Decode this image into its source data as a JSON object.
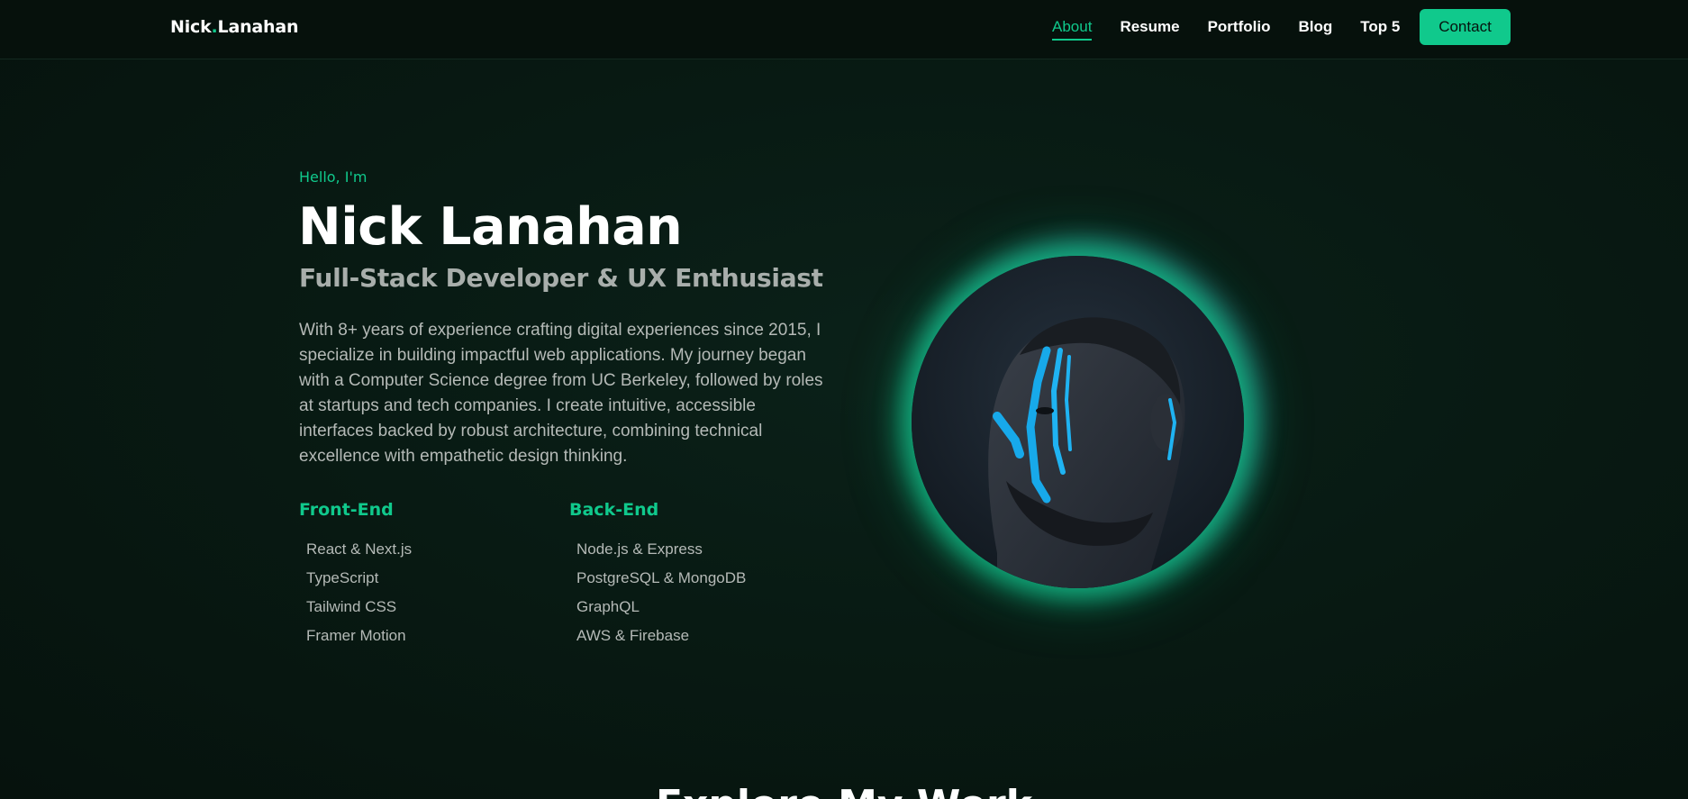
{
  "nav": {
    "logo_first": "Nick",
    "logo_dot": ".",
    "logo_last": "Lanahan",
    "links": [
      {
        "label": "About",
        "active": true
      },
      {
        "label": "Resume",
        "active": false
      },
      {
        "label": "Portfolio",
        "active": false
      },
      {
        "label": "Blog",
        "active": false
      },
      {
        "label": "Top 5",
        "active": false
      }
    ],
    "contact_label": "Contact"
  },
  "hero": {
    "greeting": "Hello, I'm",
    "name": "Nick Lanahan",
    "role": "Full-Stack Developer & UX Enthusiast",
    "bio": "With 8+ years of experience crafting digital experiences since 2015, I specialize in building impactful web applications. My journey began with a Computer Science degree from UC Berkeley, followed by roles at startups and tech companies. I create intuitive, accessible interfaces backed by robust architecture, combining technical excellence with empathetic design thinking.",
    "frontend": {
      "heading": "Front-End",
      "items": [
        "React & Next.js",
        "TypeScript",
        "Tailwind CSS",
        "Framer Motion"
      ]
    },
    "backend": {
      "heading": "Back-End",
      "items": [
        "Node.js & Express",
        "PostgreSQL & MongoDB",
        "GraphQL",
        "AWS & Firebase"
      ]
    },
    "portrait_icon": "profile-photo"
  },
  "next_section": {
    "title": "Explore My Work"
  },
  "colors": {
    "accent": "#10c98c",
    "background": "#071410",
    "muted_text": "#b5bab7",
    "role_text": "#a8aeab"
  }
}
